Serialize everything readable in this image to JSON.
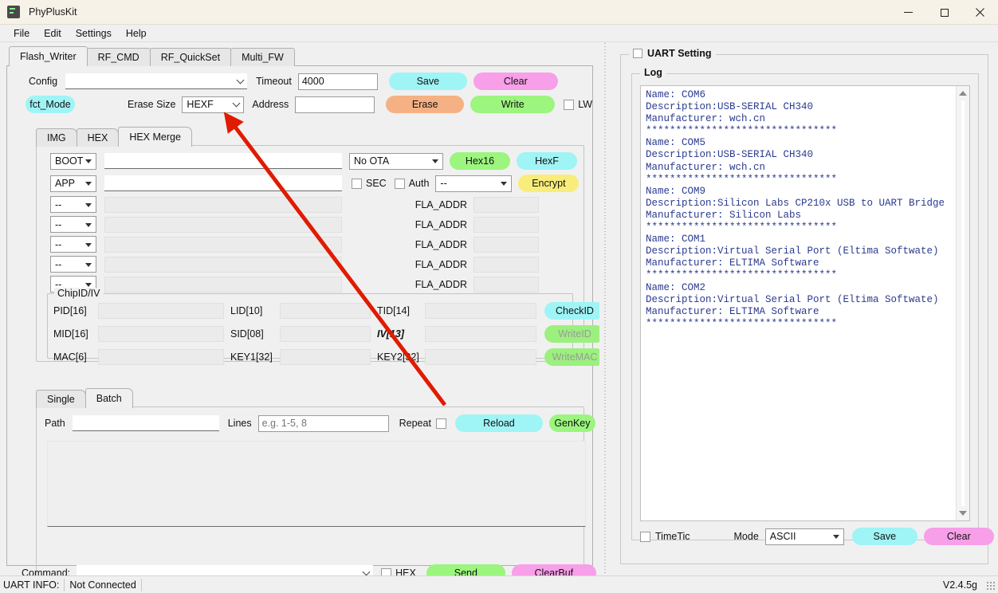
{
  "window": {
    "title": "PhyPlusKit",
    "icon": "app-icon",
    "minimize": "—",
    "maximize": "□",
    "close": "✕"
  },
  "menubar": {
    "items": [
      "File",
      "Edit",
      "Settings",
      "Help"
    ]
  },
  "main_tabs": [
    {
      "label": "Flash_Writer",
      "active": true
    },
    {
      "label": "RF_CMD",
      "active": false
    },
    {
      "label": "RF_QuickSet",
      "active": false
    },
    {
      "label": "Multi_FW",
      "active": false
    }
  ],
  "toolbar": {
    "config_label": "Config",
    "config_value": "",
    "timeout_label": "Timeout",
    "timeout_value": "4000",
    "save_label": "Save",
    "clear_label": "Clear",
    "fct_mode_label": "fct_Mode",
    "erase_size_label": "Erase Size",
    "erase_size_value": "HEXF",
    "address_label": "Address",
    "address_value": "",
    "erase_label": "Erase",
    "write_label": "Write",
    "lw_label": "LW",
    "lw_checked": false
  },
  "inner_tabs": [
    {
      "label": "IMG",
      "active": false
    },
    {
      "label": "HEX",
      "active": false
    },
    {
      "label": "HEX Merge",
      "active": true
    }
  ],
  "hexmerge": {
    "rows": [
      {
        "type": "BOOT",
        "path": "",
        "style": "flat"
      },
      {
        "type": "APP",
        "path": "",
        "style": "flat"
      },
      {
        "type": "--",
        "path": "",
        "style": "grey",
        "addr_label": "FLA_ADDR",
        "addr_value": ""
      },
      {
        "type": "--",
        "path": "",
        "style": "grey",
        "addr_label": "FLA_ADDR",
        "addr_value": ""
      },
      {
        "type": "--",
        "path": "",
        "style": "grey",
        "addr_label": "FLA_ADDR",
        "addr_value": ""
      },
      {
        "type": "--",
        "path": "",
        "style": "grey",
        "addr_label": "FLA_ADDR",
        "addr_value": ""
      },
      {
        "type": "--",
        "path": "",
        "style": "grey",
        "addr_label": "FLA_ADDR",
        "addr_value": ""
      }
    ],
    "ota_value": "No OTA",
    "hex16_label": "Hex16",
    "hexf_label": "HexF",
    "sec_label": "SEC",
    "sec_checked": false,
    "auth_label": "Auth",
    "auth_checked": false,
    "auth_mode_value": "--",
    "encrypt_label": "Encrypt"
  },
  "chipid": {
    "group_title": "ChipID/IV",
    "fields": [
      {
        "label": "PID[16]",
        "value": "",
        "italic": false
      },
      {
        "label": "LID[10]",
        "value": "",
        "italic": false
      },
      {
        "label": "TID[14]",
        "value": "",
        "italic": false
      },
      {
        "label": "MID[16]",
        "value": "",
        "italic": false
      },
      {
        "label": "SID[08]",
        "value": "",
        "italic": false
      },
      {
        "label": "IV[13]",
        "value": "",
        "italic": true
      },
      {
        "label": "MAC[6]",
        "value": "",
        "italic": false
      },
      {
        "label": "KEY1[32]",
        "value": "",
        "italic": false
      },
      {
        "label": "KEY2[32]",
        "value": "",
        "italic": false
      }
    ],
    "check_id_label": "CheckID",
    "write_id_label": "WriteID",
    "write_mac_label": "WriteMAC"
  },
  "batch": {
    "tabs": [
      {
        "label": "Single",
        "active": false
      },
      {
        "label": "Batch",
        "active": true
      }
    ],
    "path_label": "Path",
    "path_value": "",
    "lines_label": "Lines",
    "lines_value": "",
    "lines_placeholder": "e.g. 1-5, 8",
    "repeat_label": "Repeat",
    "repeat_checked": false,
    "reload_label": "Reload",
    "genkey_label": "GenKey",
    "list_content": ""
  },
  "command": {
    "label": "Command:",
    "value": "",
    "hex_label": "HEX",
    "hex_checked": false,
    "send_label": "Send",
    "clearbuf_label": "ClearBuf"
  },
  "uart": {
    "setting_label": "UART Setting",
    "setting_checked": false,
    "log_title": "Log",
    "log_text": "Name: COM6\nDescription:USB-SERIAL CH340\nManufacturer: wch.cn\n********************************\nName: COM5\nDescription:USB-SERIAL CH340\nManufacturer: wch.cn\n********************************\nName: COM9\nDescription:Silicon Labs CP210x USB to UART Bridge\nManufacturer: Silicon Labs\n********************************\nName: COM1\nDescription:Virtual Serial Port (Eltima Softwate)\nManufacturer: ELTIMA Software\n********************************\nName: COM2\nDescription:Virtual Serial Port (Eltima Softwate)\nManufacturer: ELTIMA Software\n********************************",
    "timetic_label": "TimeTic",
    "timetic_checked": false,
    "mode_label": "Mode",
    "mode_value": "ASCII",
    "save_label": "Save",
    "clear_label": "Clear"
  },
  "statusbar": {
    "info_label": "UART INFO:",
    "info_value": "Not Connected",
    "version": "V2.4.5g"
  },
  "colors": {
    "cyan": "#9ff4f6",
    "magenta": "#f79fe8",
    "orange": "#f5b183",
    "green": "#9cf57e",
    "yellow": "#f8ed7a",
    "green_soft": "#9cf07e",
    "titlebar": "#f7f2e8",
    "log_text": "#2b3a8f",
    "annotation_arrow": "#e01b00"
  },
  "annotation": {
    "type": "arrow",
    "points": "from (558,508) to (280,142)",
    "color": "#e01b00",
    "target": "erase-size-combo"
  }
}
